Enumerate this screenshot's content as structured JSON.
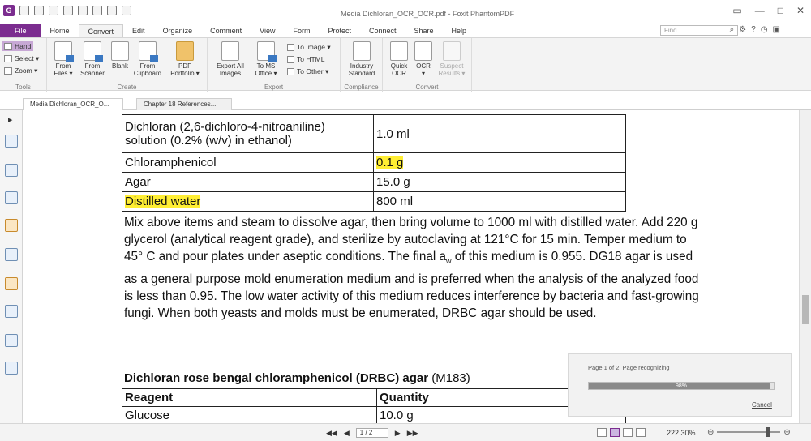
{
  "window": {
    "title": "Media Dichloran_OCR_OCR.pdf - Foxit PhantomPDF",
    "logo": "G",
    "controls": [
      "▭",
      "—",
      "□",
      "✕"
    ]
  },
  "menu_tabs": [
    "File",
    "Home",
    "Convert",
    "Edit",
    "Organize",
    "Comment",
    "View",
    "Form",
    "Protect",
    "Connect",
    "Share",
    "Help"
  ],
  "active_tab": "Convert",
  "find": {
    "placeholder": "Find",
    "icons": [
      "⌕",
      "⚙",
      "?",
      "◷",
      "▣"
    ]
  },
  "ribbon": {
    "tools": {
      "label": "Tools",
      "hand": "Hand",
      "select": "Select ▾",
      "zoom": "Zoom ▾"
    },
    "create": {
      "label": "Create",
      "from_files": [
        "From",
        "Files ▾"
      ],
      "from_scanner": [
        "From",
        "Scanner"
      ],
      "blank": [
        "Blank",
        ""
      ],
      "from_clipboard": [
        "From",
        "Clipboard"
      ],
      "pdf_portfolio": [
        "PDF",
        "Portfolio ▾"
      ]
    },
    "export": {
      "label": "Export",
      "export_all_images": [
        "Export All",
        "Images"
      ],
      "to_ms_office": [
        "To MS",
        "Office ▾"
      ],
      "to_image": "To Image ▾",
      "to_html": "To HTML",
      "to_other": "To Other ▾"
    },
    "compliance": {
      "label": "Compliance",
      "industry_standard": [
        "Industry",
        "Standard"
      ]
    },
    "convert": {
      "label": "Convert",
      "quick_ocr": [
        "Quick",
        "OCR"
      ],
      "ocr": [
        "OCR",
        "▾"
      ],
      "suspect_results": [
        "Suspect",
        "Results ▾"
      ]
    }
  },
  "doc_tabs": [
    "Media Dichloran_OCR_O...",
    "Chapter 18 References..."
  ],
  "document": {
    "table1": [
      [
        "Dichloran (2,6-dichloro-4-nitroaniline)\nsolution (0.2% (w/v) in ethanol)",
        "1.0 ml"
      ],
      [
        "Chloramphenicol",
        "0.1 g"
      ],
      [
        "Agar",
        "15.0 g"
      ],
      [
        "Distilled water",
        "800 ml"
      ]
    ],
    "para_before_a": "Mix above items and steam to dissolve agar, then bring volume to 1000 ml with distilled water. Add 220 g glycerol (analytical reagent grade), and sterilize by autoclaving at 121°C for 15 min. Temper medium to 45° C and pour plates under aseptic conditions. The final a",
    "para_sub": "w",
    "para_after_a": " of this medium is 0.955. DG18 agar is used as a general purpose mold enumeration medium and is preferred when the analysis of the analyzed food is less than 0.95. The low water activity of this medium reduces interference by bacteria and fast-growing fungi. When both yeasts and molds must be enumerated, DRBC agar should be used.",
    "heading": "Dichloran rose bengal chloramphenicol (DRBC) agar",
    "heading_code": " (M183)",
    "table2_header": [
      "Reagent",
      "Quantity"
    ],
    "table2_row": [
      "Glucose",
      "10.0 g"
    ]
  },
  "ocr_progress": {
    "status": "Page 1  of  2: Page recognizing",
    "percent": 98,
    "percent_label": "98%",
    "cancel": "Cancel"
  },
  "statusbar": {
    "page": "1 / 2",
    "zoom": "222.30%",
    "nav_glyphs": [
      "◀◀",
      "◀",
      "▶",
      "▶▶"
    ],
    "zoom_minus": "⊖",
    "zoom_plus": "⊕",
    "zoom_level": 0.82
  }
}
